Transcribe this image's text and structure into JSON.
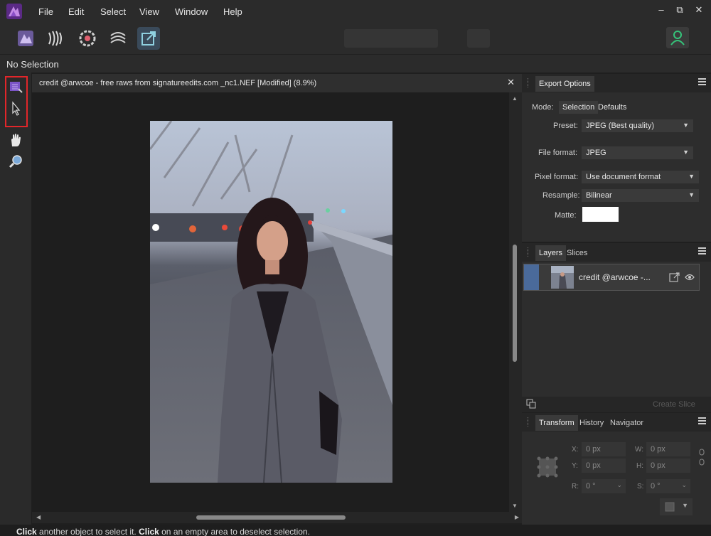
{
  "menu": [
    "File",
    "Edit",
    "Select",
    "View",
    "Window",
    "Help"
  ],
  "window_controls": {
    "minimize": "–",
    "restore": "⧉",
    "close": "✕"
  },
  "context": {
    "selection": "No Selection"
  },
  "document": {
    "title": "credit @arwcoe - free raws from signatureedits.com _nc1.NEF [Modified] (8.9%)",
    "close": "✕"
  },
  "status": {
    "click1": "Click",
    "text1": " another object to select it. ",
    "click2": "Click",
    "text2": " on an empty area to deselect selection."
  },
  "export_options": {
    "tab": "Export Options",
    "mode_label": "Mode:",
    "mode_selection": "Selection",
    "mode_defaults": "Defaults",
    "preset_label": "Preset:",
    "preset_value": "JPEG (Best quality)",
    "file_format_label": "File format:",
    "file_format_value": "JPEG",
    "pixel_format_label": "Pixel format:",
    "pixel_format_value": "Use document format",
    "resample_label": "Resample:",
    "resample_value": "Bilinear",
    "matte_label": "Matte:"
  },
  "layers": {
    "tabs": [
      "Layers",
      "Slices"
    ],
    "layer_name": "credit @arwcoe -...",
    "create_slice": "Create Slice"
  },
  "transform": {
    "tabs": [
      "Transform",
      "History",
      "Navigator"
    ],
    "x_label": "X:",
    "x_value": "0 px",
    "y_label": "Y:",
    "y_value": "0 px",
    "w_label": "W:",
    "w_value": "0 px",
    "h_label": "H:",
    "h_value": "0 px",
    "r_label": "R:",
    "r_value": "0 °",
    "s_label": "S:",
    "s_value": "0 °"
  },
  "colors": {
    "accent": "#4a7fb5",
    "highlight": "#e2262a",
    "user": "#35c47a"
  }
}
